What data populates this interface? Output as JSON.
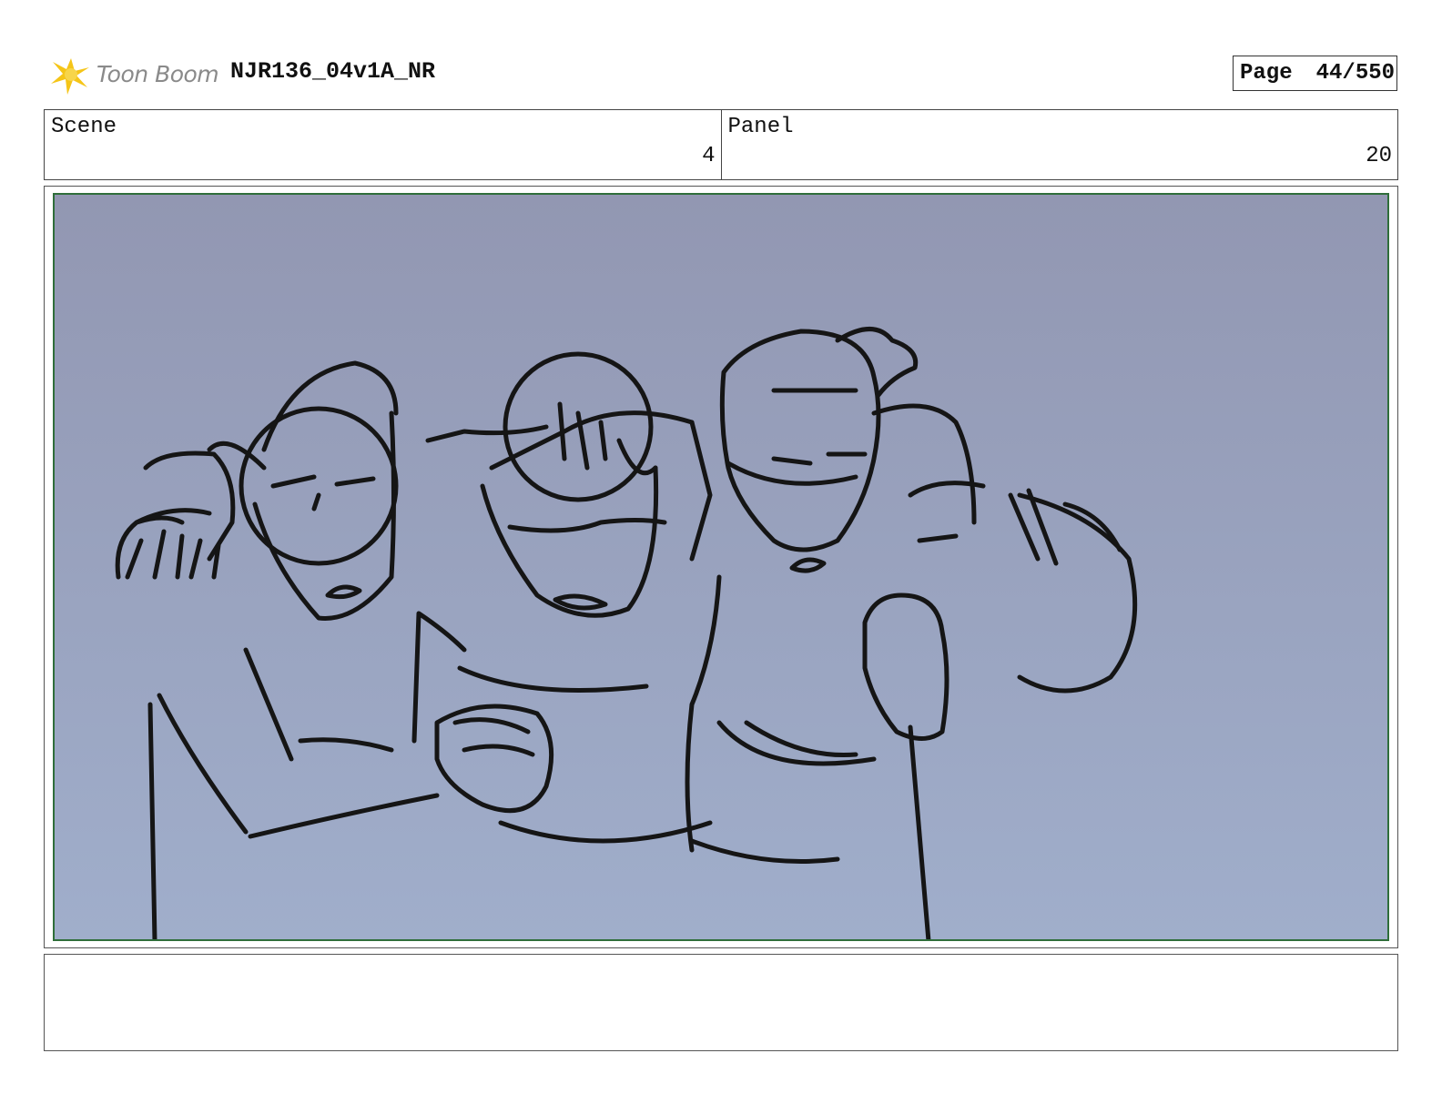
{
  "header": {
    "logo_text": "Toon Boom",
    "doc_title": "NJR136_04v1A_NR",
    "page_label": "Page",
    "page_number": "44/550"
  },
  "info": {
    "scene_label": "Scene",
    "scene_value": "4",
    "panel_label": "Panel",
    "panel_value": "20"
  },
  "panel": {
    "description": "",
    "background_top": "#9297b2",
    "background_bottom": "#a0aecb",
    "border_color": "#2f6e3a"
  },
  "notes": {
    "text": ""
  },
  "icons": {
    "logo": "sunburst-icon"
  }
}
